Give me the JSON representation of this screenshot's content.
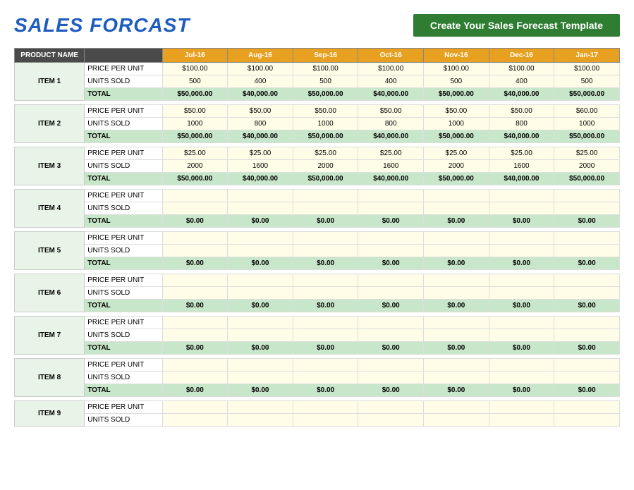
{
  "title": "SALES FORCAST",
  "banner": "Create Your Sales Forecast Template",
  "table": {
    "headers": {
      "product_col": "PRODUCT NAME",
      "label_col": "",
      "months": [
        "Jul-16",
        "Aug-16",
        "Sep-16",
        "Oct-16",
        "Nov-16",
        "Dec-16",
        "Jan-17"
      ]
    },
    "items": [
      {
        "name": "ITEM 1",
        "price": [
          "$100.00",
          "$100.00",
          "$100.00",
          "$100.00",
          "$100.00",
          "$100.00",
          "$100.00"
        ],
        "units": [
          "500",
          "400",
          "500",
          "400",
          "500",
          "400",
          "500"
        ],
        "total": [
          "$50,000.00",
          "$40,000.00",
          "$50,000.00",
          "$40,000.00",
          "$50,000.00",
          "$40,000.00",
          "$50,000.00"
        ]
      },
      {
        "name": "ITEM 2",
        "price": [
          "$50.00",
          "$50.00",
          "$50.00",
          "$50.00",
          "$50.00",
          "$50.00",
          "$60.00"
        ],
        "units": [
          "1000",
          "800",
          "1000",
          "800",
          "1000",
          "800",
          "1000"
        ],
        "total": [
          "$50,000.00",
          "$40,000.00",
          "$50,000.00",
          "$40,000.00",
          "$50,000.00",
          "$40,000.00",
          "$50,000.00"
        ]
      },
      {
        "name": "ITEM 3",
        "price": [
          "$25.00",
          "$25.00",
          "$25.00",
          "$25.00",
          "$25.00",
          "$25.00",
          "$25.00"
        ],
        "units": [
          "2000",
          "1600",
          "2000",
          "1600",
          "2000",
          "1600",
          "2000"
        ],
        "total": [
          "$50,000.00",
          "$40,000.00",
          "$50,000.00",
          "$40,000.00",
          "$50,000.00",
          "$40,000.00",
          "$50,000.00"
        ]
      },
      {
        "name": "ITEM 4",
        "price": [
          "",
          "",
          "",
          "",
          "",
          "",
          ""
        ],
        "units": [
          "",
          "",
          "",
          "",
          "",
          "",
          ""
        ],
        "total": [
          "$0.00",
          "$0.00",
          "$0.00",
          "$0.00",
          "$0.00",
          "$0.00",
          "$0.00"
        ]
      },
      {
        "name": "ITEM 5",
        "price": [
          "",
          "",
          "",
          "",
          "",
          "",
          ""
        ],
        "units": [
          "",
          "",
          "",
          "",
          "",
          "",
          ""
        ],
        "total": [
          "$0.00",
          "$0.00",
          "$0.00",
          "$0.00",
          "$0.00",
          "$0.00",
          "$0.00"
        ]
      },
      {
        "name": "ITEM 6",
        "price": [
          "",
          "",
          "",
          "",
          "",
          "",
          ""
        ],
        "units": [
          "",
          "",
          "",
          "",
          "",
          "",
          ""
        ],
        "total": [
          "$0.00",
          "$0.00",
          "$0.00",
          "$0.00",
          "$0.00",
          "$0.00",
          "$0.00"
        ]
      },
      {
        "name": "ITEM 7",
        "price": [
          "",
          "",
          "",
          "",
          "",
          "",
          ""
        ],
        "units": [
          "",
          "",
          "",
          "",
          "",
          "",
          ""
        ],
        "total": [
          "$0.00",
          "$0.00",
          "$0.00",
          "$0.00",
          "$0.00",
          "$0.00",
          "$0.00"
        ]
      },
      {
        "name": "ITEM 8",
        "price": [
          "",
          "",
          "",
          "",
          "",
          "",
          ""
        ],
        "units": [
          "",
          "",
          "",
          "",
          "",
          "",
          ""
        ],
        "total": [
          "$0.00",
          "$0.00",
          "$0.00",
          "$0.00",
          "$0.00",
          "$0.00",
          "$0.00"
        ]
      },
      {
        "name": "ITEM 9",
        "price": [
          "",
          "",
          "",
          "",
          "",
          "",
          ""
        ],
        "units": [
          "",
          "",
          "",
          "",
          "",
          "",
          ""
        ],
        "total": null
      }
    ],
    "row_labels": {
      "price": "PRICE PER UNIT",
      "units": "UNITS SOLD",
      "total": "TOTAL"
    }
  }
}
